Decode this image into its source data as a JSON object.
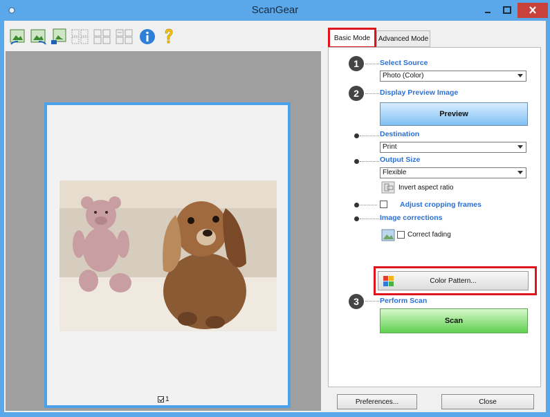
{
  "window": {
    "title": "ScanGear"
  },
  "toolbar": {
    "icons": [
      "rotate-left-icon",
      "rotate-right-icon",
      "auto-crop-icon",
      "thumbnail-view-icon",
      "whole-image-icon",
      "clear-frames-icon",
      "info-icon",
      "help-icon"
    ]
  },
  "preview": {
    "page_number": "1"
  },
  "tabs": {
    "basic": "Basic Mode",
    "advanced": "Advanced Mode"
  },
  "steps": {
    "one": "1",
    "two": "2",
    "three": "3",
    "select_source": "Select Source",
    "source_value": "Photo (Color)",
    "display_preview": "Display Preview Image",
    "preview_button": "Preview",
    "destination": "Destination",
    "destination_value": "Print",
    "output_size": "Output Size",
    "output_size_value": "Flexible",
    "invert_aspect": "Invert aspect ratio",
    "adjust_cropping": "Adjust cropping frames",
    "image_corrections": "Image corrections",
    "correct_fading": "Correct fading",
    "color_pattern": "Color Pattern...",
    "perform_scan": "Perform Scan",
    "scan_button": "Scan"
  },
  "footer": {
    "preferences": "Preferences...",
    "close": "Close"
  },
  "colors": {
    "titlebar": "#5aa7ea",
    "heading": "#2a6fd6",
    "highlight": "#e0141b",
    "preview_btn": "#7fc0f2",
    "scan_btn": "#5fd04e"
  }
}
